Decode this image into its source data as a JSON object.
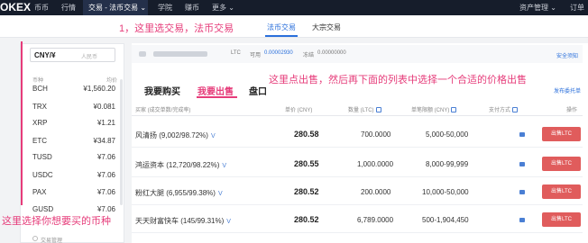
{
  "topnav": {
    "logo": "OKEX",
    "items": [
      "币币",
      "行情",
      "交易 - 法币交易",
      "学院",
      "赚币",
      "更多"
    ],
    "right_items": [
      "资产管理",
      "订单"
    ]
  },
  "subheader": {
    "tabs": [
      "法币交易",
      "大宗交易"
    ]
  },
  "annotations": {
    "a1": "1，这里选交易，法币交易",
    "a2": "这里点出售，然后再下面的列表中选择一个合适的价格出售",
    "a3": "这里选择你想要买的币种"
  },
  "left_panel": {
    "currency": "CNY/¥",
    "currency_hint": "人民币",
    "header_coin": "币种",
    "header_price": "均价",
    "coins": [
      {
        "name": "BCH",
        "price": "¥1,560.20"
      },
      {
        "name": "TRX",
        "price": "¥0.081"
      },
      {
        "name": "XRP",
        "price": "¥1.21"
      },
      {
        "name": "ETC",
        "price": "¥34.87"
      },
      {
        "name": "TUSD",
        "price": "¥7.06"
      },
      {
        "name": "USDC",
        "price": "¥7.06"
      },
      {
        "name": "PAX",
        "price": "¥7.06"
      },
      {
        "name": "GUSD",
        "price": "¥7.06"
      }
    ],
    "footer": "交易管理"
  },
  "info_bar": {
    "ltc_label": "LTC",
    "available_label": "可用",
    "available_val": "0.00002930",
    "frozen_label": "冻结",
    "frozen_val": "0.00000000",
    "security_link": "安全须知"
  },
  "trade_tabs": {
    "buy": "我要购买",
    "sell": "我要出售",
    "third": "盘口",
    "post_ad": "发布委托单"
  },
  "table": {
    "headers": {
      "buyer": "买家 (成交单数/完成率)",
      "price": "单价 (CNY)",
      "qty": "数量 (LTC)",
      "limit": "单笔限额 (CNY)",
      "pay": "支付方式",
      "action": "操作"
    },
    "rows": [
      {
        "buyer": "风清扬 (9,002/98.72%)",
        "v": "V",
        "price": "280.58",
        "qty": "700.0000",
        "limit": "5,000-50,000",
        "btn": "出售LTC"
      },
      {
        "buyer": "鸿运资本 (12,720/98.22%)",
        "v": "V",
        "price": "280.55",
        "qty": "1,000.0000",
        "limit": "8,000-99,999",
        "btn": "出售LTC"
      },
      {
        "buyer": "粉红大腿 (6,955/99.38%)",
        "v": "V",
        "price": "280.52",
        "qty": "200.0000",
        "limit": "10,000-50,000",
        "btn": "出售LTC"
      },
      {
        "buyer": "天天财富快车 (145/99.31%)",
        "v": "V",
        "price": "280.52",
        "qty": "6,789.0000",
        "limit": "500-1,904,450",
        "btn": "出售LTC"
      }
    ]
  }
}
